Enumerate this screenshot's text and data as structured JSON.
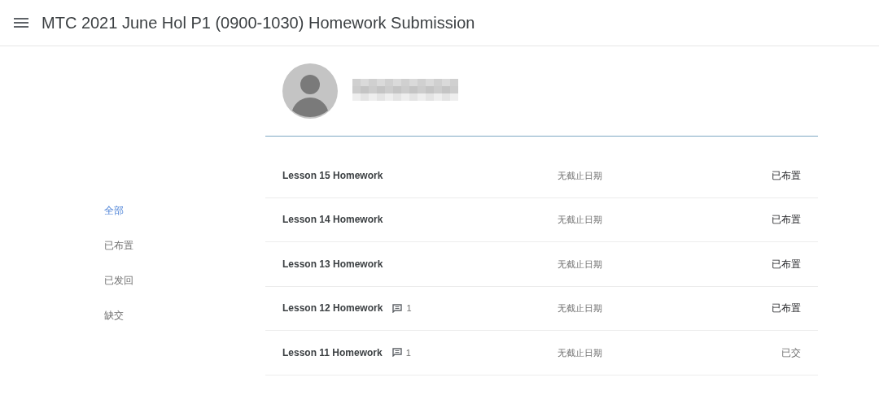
{
  "header": {
    "title": "MTC 2021 June Hol P1 (0900-1030) Homework Submission"
  },
  "filters": [
    {
      "label": "全部",
      "selected": true
    },
    {
      "label": "已布置",
      "selected": false
    },
    {
      "label": "已发回",
      "selected": false
    },
    {
      "label": "缺交",
      "selected": false
    }
  ],
  "assignments": [
    {
      "title": "Lesson 15 Homework",
      "due": "无截止日期",
      "status": "已布置",
      "turned_in": false
    },
    {
      "title": "Lesson 14 Homework",
      "due": "无截止日期",
      "status": "已布置",
      "turned_in": false
    },
    {
      "title": "Lesson 13 Homework",
      "due": "无截止日期",
      "status": "已布置",
      "turned_in": false
    },
    {
      "title": "Lesson 12 Homework",
      "comments": "1",
      "due": "无截止日期",
      "status": "已布置",
      "turned_in": false
    },
    {
      "title": "Lesson 11 Homework",
      "comments": "1",
      "due": "无截止日期",
      "status": "已交",
      "turned_in": true
    }
  ]
}
